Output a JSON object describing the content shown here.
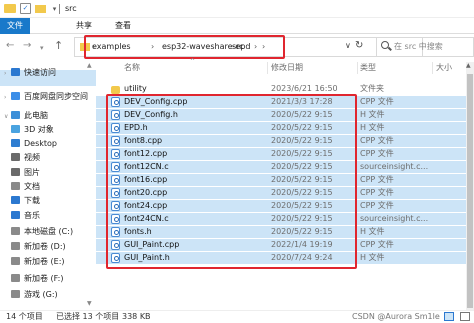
{
  "window": {
    "title": "src"
  },
  "quick_access": {
    "customize": "▾"
  },
  "ribbon": {
    "tabs": [
      "文件",
      "共享",
      "查看"
    ]
  },
  "nav": {
    "back": "←",
    "forward": "→",
    "recent": "▾",
    "up": "↑"
  },
  "address": {
    "crumbs": [
      "examples",
      "esp32-waveshare-epd",
      "src"
    ],
    "separator": "›",
    "dropdown": "∨",
    "refresh": "↻"
  },
  "search": {
    "placeholder": "在 src 中搜索"
  },
  "sidebar": {
    "items": [
      {
        "label": "快速访问",
        "icon": "star-icon",
        "color": "#2b78d0",
        "chev": "›"
      },
      {
        "label": "百度网盘同步空间",
        "icon": "cloud-icon",
        "color": "#3b8ee8",
        "chev": "›"
      },
      {
        "label": "此电脑",
        "icon": "computer-icon",
        "color": "#3c8fd8",
        "chev": "∨"
      },
      {
        "label": "3D 对象",
        "icon": "cube-icon",
        "color": "#4aa3e0",
        "chev": ""
      },
      {
        "label": "Desktop",
        "icon": "desktop-icon",
        "color": "#2e7dd1",
        "chev": ""
      },
      {
        "label": "视频",
        "icon": "video-icon",
        "color": "#6a6a6a",
        "chev": ""
      },
      {
        "label": "图片",
        "icon": "picture-icon",
        "color": "#6a6a6a",
        "chev": ""
      },
      {
        "label": "文档",
        "icon": "document-icon",
        "color": "#8a8a8a",
        "chev": ""
      },
      {
        "label": "下载",
        "icon": "download-icon",
        "color": "#2b78d0",
        "chev": ""
      },
      {
        "label": "音乐",
        "icon": "music-icon",
        "color": "#2b78d0",
        "chev": ""
      },
      {
        "label": "本地磁盘 (C:)",
        "icon": "drive-icon",
        "color": "#8a8a8a",
        "chev": ""
      },
      {
        "label": "新加卷 (D:)",
        "icon": "drive-icon",
        "color": "#8a8a8a",
        "chev": ""
      },
      {
        "label": "新加卷 (E:)",
        "icon": "drive-icon",
        "color": "#8a8a8a",
        "chev": ""
      },
      {
        "label": "新加卷 (F:)",
        "icon": "drive-icon",
        "color": "#8a8a8a",
        "chev": ""
      },
      {
        "label": "游戏 (G:)",
        "icon": "drive-icon",
        "color": "#8a8a8a",
        "chev": ""
      }
    ]
  },
  "columns": {
    "name": "名称",
    "date": "修改日期",
    "type": "类型",
    "size": "大小",
    "sort_caret": "^"
  },
  "files": [
    {
      "name": "utility",
      "date": "2023/6/21 16:50",
      "type": "文件夹",
      "size": "",
      "kind": "folder",
      "selected": false
    },
    {
      "name": "DEV_Config.cpp",
      "date": "2021/3/3 17:28",
      "type": "CPP 文件",
      "size": "",
      "kind": "file",
      "selected": true
    },
    {
      "name": "DEV_Config.h",
      "date": "2020/5/22 9:15",
      "type": "H 文件",
      "size": "",
      "kind": "file",
      "selected": true
    },
    {
      "name": "EPD.h",
      "date": "2020/5/22 9:15",
      "type": "H 文件",
      "size": "",
      "kind": "file",
      "selected": true
    },
    {
      "name": "font8.cpp",
      "date": "2020/5/22 9:15",
      "type": "CPP 文件",
      "size": "",
      "kind": "file",
      "selected": true
    },
    {
      "name": "font12.cpp",
      "date": "2020/5/22 9:15",
      "type": "CPP 文件",
      "size": "",
      "kind": "file",
      "selected": true
    },
    {
      "name": "font12CN.c",
      "date": "2020/5/22 9:15",
      "type": "sourceinsight.c...",
      "size": "",
      "kind": "file",
      "selected": true
    },
    {
      "name": "font16.cpp",
      "date": "2020/5/22 9:15",
      "type": "CPP 文件",
      "size": "",
      "kind": "file",
      "selected": true
    },
    {
      "name": "font20.cpp",
      "date": "2020/5/22 9:15",
      "type": "CPP 文件",
      "size": "",
      "kind": "file",
      "selected": true
    },
    {
      "name": "font24.cpp",
      "date": "2020/5/22 9:15",
      "type": "CPP 文件",
      "size": "",
      "kind": "file",
      "selected": true
    },
    {
      "name": "font24CN.c",
      "date": "2020/5/22 9:15",
      "type": "sourceinsight.c...",
      "size": "",
      "kind": "file",
      "selected": true
    },
    {
      "name": "fonts.h",
      "date": "2020/5/22 9:15",
      "type": "H 文件",
      "size": "",
      "kind": "file",
      "selected": true
    },
    {
      "name": "GUI_Paint.cpp",
      "date": "2022/1/4 19:19",
      "type": "CPP 文件",
      "size": "",
      "kind": "file",
      "selected": true
    },
    {
      "name": "GUI_Paint.h",
      "date": "2020/7/24 9:24",
      "type": "H 文件",
      "size": "",
      "kind": "file",
      "selected": true
    }
  ],
  "status": {
    "count": "14 个项目",
    "selected": "已选择 13 个项目",
    "size": "338 KB",
    "watermark": "CSDN @Aurora Sm1le"
  },
  "colors": {
    "accent": "#1979ca",
    "selection": "#cce4f7",
    "highlight_box": "#e0262f",
    "folder": "#f2c94c"
  }
}
